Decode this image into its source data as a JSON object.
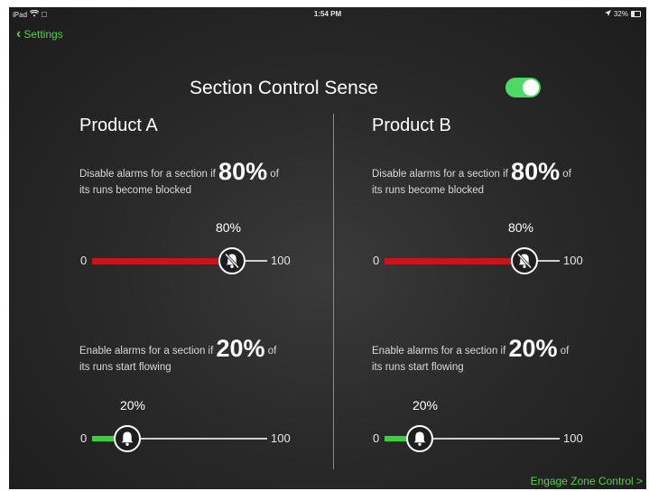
{
  "status": {
    "device": "iPad",
    "time": "1:54 PM",
    "battery": "32%",
    "battery_level": 0.32
  },
  "nav": {
    "back_label": "Settings"
  },
  "header": {
    "title": "Section Control Sense",
    "toggle_on": true
  },
  "colors": {
    "accent": "#4cd964",
    "red": "#c7161b",
    "green": "#39d03c"
  },
  "products": [
    {
      "name": "Product A",
      "disable": {
        "text_before": "Disable alarms for a section if",
        "value": "80%",
        "text_after": "of",
        "line2": "its runs become blocked",
        "slider_label": "80%",
        "min": "0",
        "max": "100",
        "level": 0.8
      },
      "enable": {
        "text_before": "Enable alarms for a section if",
        "value": "20%",
        "text_after": "of",
        "line2": "its runs start flowing",
        "slider_label": "20%",
        "min": "0",
        "max": "100",
        "level": 0.2
      }
    },
    {
      "name": "Product B",
      "disable": {
        "text_before": "Disable alarms for a section if",
        "value": "80%",
        "text_after": "of",
        "line2": "its runs become blocked",
        "slider_label": "80%",
        "min": "0",
        "max": "100",
        "level": 0.8
      },
      "enable": {
        "text_before": "Enable alarms for a section if",
        "value": "20%",
        "text_after": "of",
        "line2": "its runs start flowing",
        "slider_label": "20%",
        "min": "0",
        "max": "100",
        "level": 0.2
      }
    }
  ],
  "footer": {
    "engage_label": "Engage Zone Control >"
  }
}
